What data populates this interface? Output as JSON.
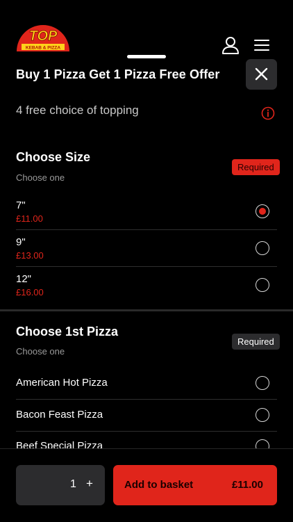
{
  "header": {
    "logo_text": "TOP",
    "logo_subtext": "KEBAB & PIZZA"
  },
  "sheet": {
    "title": "Buy 1 Pizza Get 1 Pizza Free Offer",
    "subtitle": "4 free choice of topping"
  },
  "size_section": {
    "title": "Choose Size",
    "subtitle": "Choose one",
    "badge": "Required",
    "options": [
      {
        "name": "7\"",
        "price": "£11.00",
        "selected": true
      },
      {
        "name": "9\"",
        "price": "£13.00",
        "selected": false
      },
      {
        "name": "12\"",
        "price": "£16.00",
        "selected": false
      }
    ]
  },
  "pizza_section": {
    "title": "Choose 1st Pizza",
    "subtitle": "Choose one",
    "badge": "Required",
    "options": [
      {
        "name": "American Hot Pizza",
        "selected": false
      },
      {
        "name": "Bacon Feast Pizza",
        "selected": false
      },
      {
        "name": "Beef Special Pizza",
        "selected": false
      }
    ]
  },
  "footer": {
    "quantity": "1",
    "plus": "+",
    "add_label": "Add to basket",
    "add_price": "£11.00"
  },
  "colors": {
    "accent": "#e0251b",
    "background": "#000000",
    "surface": "#2c2c2e"
  },
  "icons": [
    "logo",
    "user-icon",
    "menu-icon",
    "close-icon",
    "info-icon"
  ]
}
